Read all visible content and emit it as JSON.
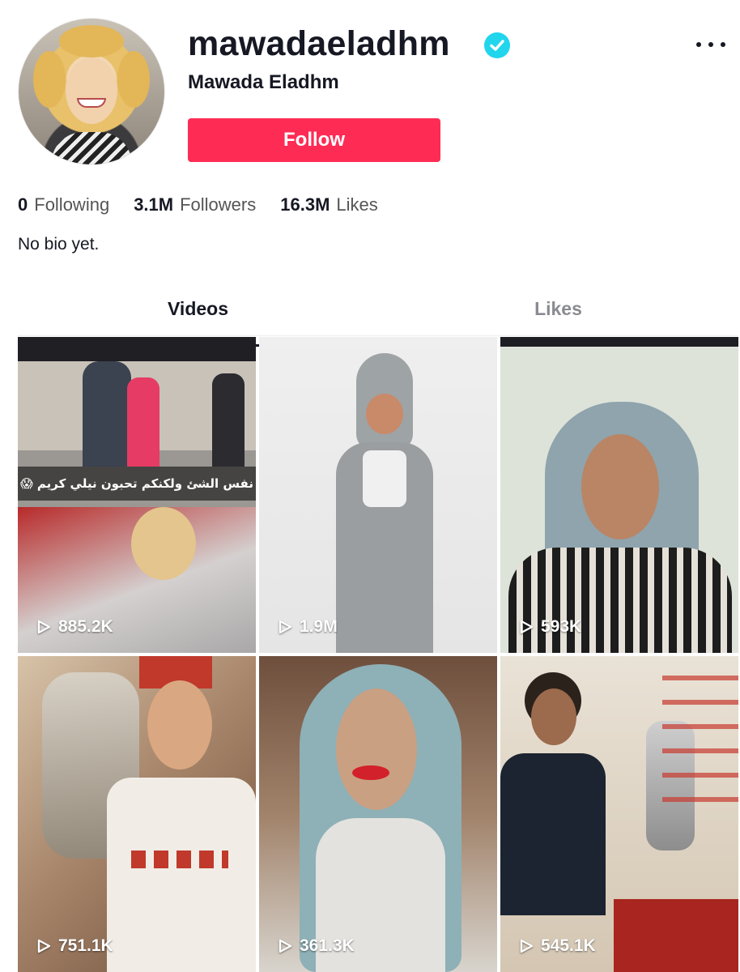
{
  "profile": {
    "username": "mawadaeladhm",
    "display_name": "Mawada Eladhm",
    "verified_icon": "verified-check-icon",
    "follow_label": "Follow",
    "more_icon": "more-dots-icon",
    "bio": "No bio yet."
  },
  "stats": [
    {
      "value": "0",
      "label": "Following"
    },
    {
      "value": "3.1M",
      "label": "Followers"
    },
    {
      "value": "16.3M",
      "label": "Likes"
    }
  ],
  "tabs": [
    {
      "label": "Videos",
      "active": true
    },
    {
      "label": "Likes",
      "active": false
    }
  ],
  "videos": [
    {
      "views": "885.2K",
      "caption": "نفس الشئ ولكنكم تحبون نيلي كريم 😱"
    },
    {
      "views": "1.9M"
    },
    {
      "views": "593K"
    },
    {
      "views": "751.1K"
    },
    {
      "views": "361.3K"
    },
    {
      "views": "545.1K"
    }
  ],
  "colors": {
    "accent": "#fe2c55",
    "verified": "#20d5ec",
    "text": "#161823",
    "muted": "#8a8b91"
  }
}
